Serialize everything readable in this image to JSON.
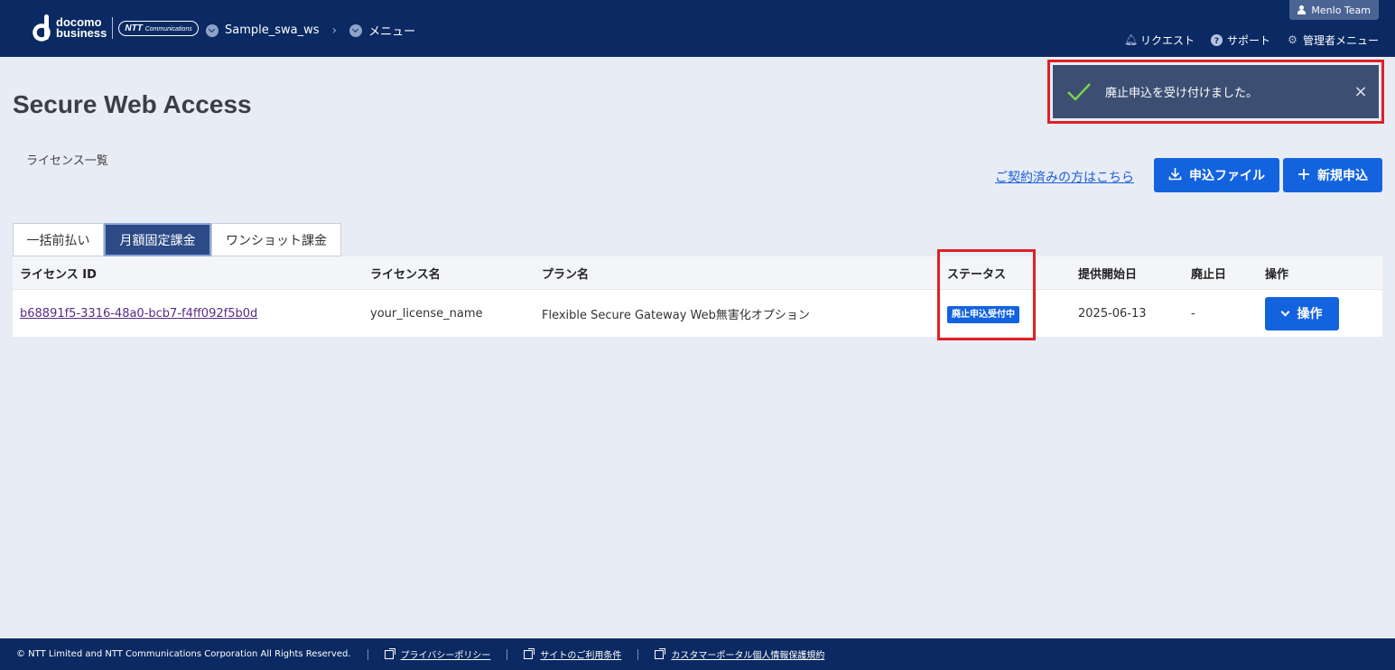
{
  "header": {
    "logo_text_line1": "docomo",
    "logo_text_line2": "business",
    "ntt_logo": "NTT",
    "ntt_logo_sub": "Communications",
    "breadcrumbs": [
      "Sample_swa_ws",
      "メニュー"
    ],
    "team": "Menlo Team",
    "nav": [
      {
        "label": "リクエスト",
        "icon": "bell-icon"
      },
      {
        "label": "サポート",
        "icon": "question-icon"
      },
      {
        "label": "管理者メニュー",
        "icon": "gear-icon"
      }
    ]
  },
  "page": {
    "title": "Secure Web Access",
    "subtitle": "ライセンス一覧"
  },
  "toast": {
    "message": "廃止申込を受け付けました。",
    "close": "×"
  },
  "actions": {
    "contract_link": "ご契約済みの方はこちら",
    "file_button": "申込ファイル",
    "new_button": "新規申込"
  },
  "tabs": [
    "一括前払い",
    "月額固定課金",
    "ワンショット課金"
  ],
  "table": {
    "headers": [
      "ライセンス ID",
      "ライセンス名",
      "プラン名",
      "ステータス",
      "提供開始日",
      "廃止日",
      "操作"
    ],
    "rows": [
      {
        "license_id": "b68891f5-3316-48a0-bcb7-f4ff092f5b0d",
        "license_name": "your_license_name",
        "plan_name": "Flexible Secure Gateway Web無害化オプション",
        "status": "廃止申込受付中",
        "start_date": "2025-06-13",
        "end_date": "-",
        "action": "操作"
      }
    ]
  },
  "footer": {
    "copyright": "© NTT Limited and NTT Communications Corporation All Rights Reserved.",
    "links": [
      "プライバシーポリシー",
      "サイトのご利用条件",
      "カスタマーポータル個人情報保護規約"
    ]
  },
  "colors": {
    "header_bg": "#0b2a63",
    "primary": "#1363df",
    "highlight": "#e02027"
  }
}
